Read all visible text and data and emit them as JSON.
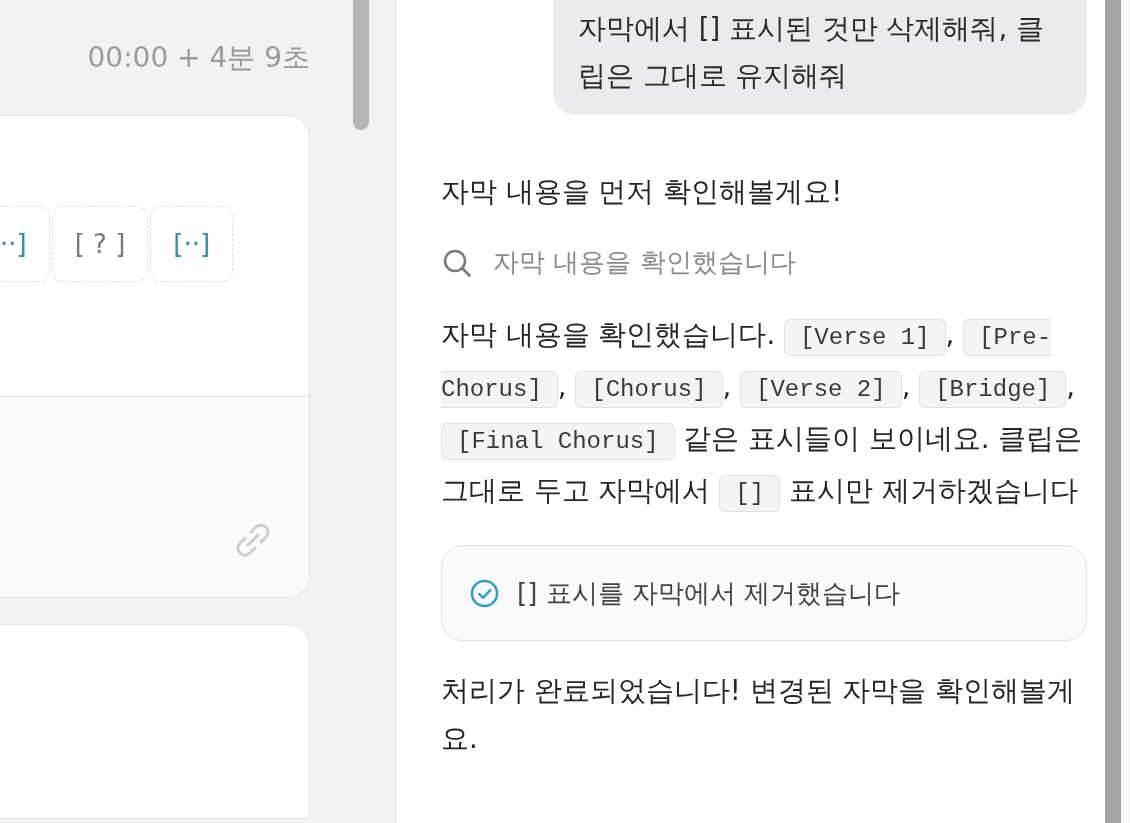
{
  "timeline": {
    "time_range": "00:00 + 4분 9초"
  },
  "clip_card": {
    "markers": [
      {
        "text": "··]",
        "color": "#2e8fae"
      },
      {
        "text": "[ ? ]",
        "color": "#7a7a7a"
      },
      {
        "text": "[··]",
        "color": "#2e8fae"
      }
    ]
  },
  "chat": {
    "messages": [
      {
        "kind": "user",
        "text": "자막에서 [] 표시된 것만 삭제해줘, 클립은 그대로 유지해줘"
      },
      {
        "kind": "assistant",
        "text": "자막 내용을 먼저 확인해볼게요!"
      },
      {
        "kind": "tool_call",
        "text": "자막 내용을 확인했습니다"
      },
      {
        "kind": "rich_text",
        "segments": [
          {
            "kind": "text",
            "text": "자막 내용을 확인했습니다. "
          },
          {
            "kind": "code",
            "text": "[Verse 1]"
          },
          {
            "kind": "text",
            "text": ", "
          },
          {
            "kind": "code",
            "text": "[Pre-Chorus]"
          },
          {
            "kind": "text",
            "text": ", "
          },
          {
            "kind": "code",
            "text": "[Chorus]"
          },
          {
            "kind": "text",
            "text": ", "
          },
          {
            "kind": "code",
            "text": "[Verse 2]"
          },
          {
            "kind": "text",
            "text": ", "
          },
          {
            "kind": "code",
            "text": "[Bridge]"
          },
          {
            "kind": "text",
            "text": ", "
          },
          {
            "kind": "code",
            "text": "[Final Chorus]"
          },
          {
            "kind": "text",
            "text": " 같은 표시들이 보이네요. 클립은 그대로 두고 자막에서 "
          },
          {
            "kind": "code",
            "text": "[]"
          },
          {
            "kind": "text",
            "text": " 표시만 제거하겠습니다"
          }
        ]
      },
      {
        "kind": "tool_result",
        "text": "[] 표시를 자막에서 제거했습니다"
      },
      {
        "kind": "assistant",
        "text": "처리가 완료되었습니다! 변경된 자막을 확인해볼게요."
      }
    ]
  }
}
